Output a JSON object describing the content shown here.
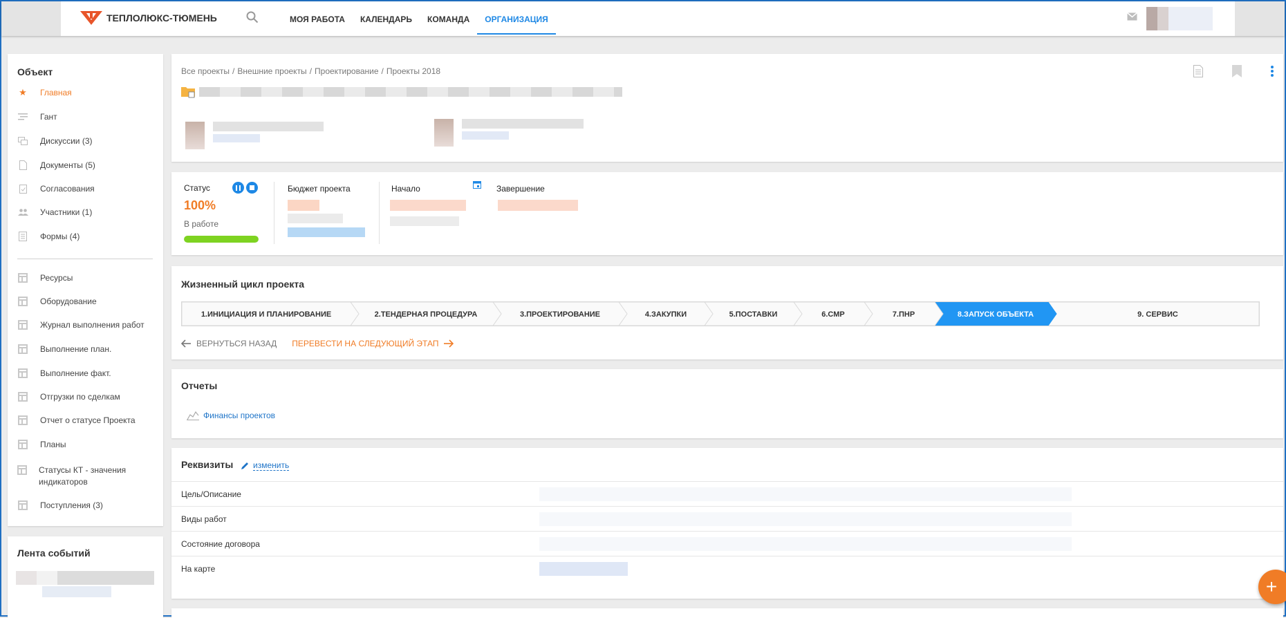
{
  "app": {
    "brand": "ТЕПЛОЛЮКС-ТЮМЕНЬ",
    "nav": [
      "МОЯ РАБОТА",
      "КАЛЕНДАРЬ",
      "КОМАНДА",
      "ОРГАНИЗАЦИЯ"
    ],
    "active_nav": "ОРГАНИЗАЦИЯ",
    "accent": "#1e88e5",
    "brand_color": "#f07c26"
  },
  "sidebar": {
    "title": "Объект",
    "items": [
      {
        "label": "Главная",
        "icon": "star-icon",
        "active": true
      },
      {
        "label": "Гант",
        "icon": "gantt-icon"
      },
      {
        "label": "Дискуссии (3)",
        "icon": "discussion-icon"
      },
      {
        "label": "Документы (5)",
        "icon": "document-icon"
      },
      {
        "label": "Согласования",
        "icon": "approval-icon"
      },
      {
        "label": "Участники (1)",
        "icon": "people-icon"
      },
      {
        "label": "Формы (4)",
        "icon": "form-icon"
      }
    ],
    "tables": [
      "Ресурсы",
      "Оборудование",
      "Журнал выполнения работ",
      "Выполнение план.",
      "Выполнение факт.",
      "Отгрузки по сделкам",
      "Отчет о статусе Проекта",
      "Планы",
      "Статусы КТ - значения индикаторов",
      "Поступления (3)"
    ]
  },
  "feed": {
    "title": "Лента событий"
  },
  "breadcrumb": [
    "Все проекты",
    "Внешние проекты",
    "Проектирование",
    "Проекты 2018"
  ],
  "status": {
    "label": "Статус",
    "percent": "100%",
    "progress": 1.0,
    "state": "В работе",
    "budget_label": "Бюджет проекта",
    "start_label": "Начало",
    "end_label": "Завершение"
  },
  "lifecycle": {
    "title": "Жизненный цикл проекта",
    "steps": [
      "1.ИНИЦИАЦИЯ И ПЛАНИРОВАНИЕ",
      "2.ТЕНДЕРНАЯ ПРОЦЕДУРА",
      "3.ПРОЕКТИРОВАНИЕ",
      "4.ЗАКУПКИ",
      "5.ПОСТАВКИ",
      "6.СМР",
      "7.ПНР",
      "8.ЗАПУСК ОБЪЕКТА",
      "9. СЕРВИС"
    ],
    "active_step": 7,
    "back_label": "ВЕРНУТЬСЯ НАЗАД",
    "next_label": "ПЕРЕВЕСТИ НА СЛЕДУЮЩИЙ ЭТАП"
  },
  "reports": {
    "title": "Отчеты",
    "link": "Финансы проектов"
  },
  "requisites": {
    "title": "Реквизиты",
    "edit_label": "изменить",
    "rows": [
      "Цель/Описание",
      "Виды работ",
      "Состояние договора",
      "На карте"
    ]
  }
}
